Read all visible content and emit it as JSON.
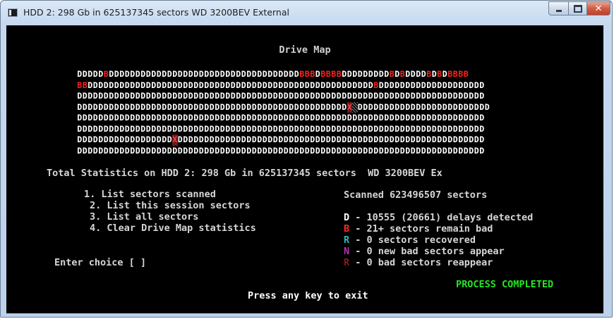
{
  "window": {
    "title": "HDD 2: 298 Gb in 625137345 sectors  WD 3200BEV External",
    "controls": {
      "minimize": "minimize-icon",
      "maximize": "maximize-icon",
      "close": "close-icon"
    }
  },
  "console": {
    "heading": "Drive Map",
    "map_rows": [
      "DDDDDBDDDDDDDDDDDDDDDDDDDDDDDDDDDDDDDDDDDDBBBDBBBBDDDDDDDDDBDBDDDDBDBDBBBB",
      "BBDDDDDDDDDDDDDDDDDDDDDDDDDDDDDDDDDDDDDDDDDDDDDDDDDDDDDDBDDDDDDDDDDDDDDDDDDDD",
      "DDDDDDDDDDDDDDDDDDDDDDDDDDDDDDDDDDDDDDDDDDDDDDDDDDDDDDDDDDDDDDDDDDDDDDDDDDDDD",
      "DDDDDDDDDDDDDDDDDDDDDDDDDDDDDDDDDDDDDDDDDDDDDDDDDDDXHDDDDDDDDDDDDDDDDDDDDDDDDD",
      "DDDDDDDDDDDDDDDDDDDDDDDDDDDDDDDDDDDDDDDDDDDDDDDDDDDDDDDDDDDDDDDDDDDDDDDDDDDDD",
      "DDDDDDDDDDDDDDDDDDDDDDDDDDDDDDDDDDDDDDDDDDDDDDDDDDDDDDDDDDDDDDDDDDDDDDDDDDDDD",
      "DDDDDDDDDDDDDDDDDDXDDDDDDDDDDDDDDDDDDDDDDDDDDDDDDDDDDDDDDDDDDDDDDDDDDDDDDDDDD",
      "DDDDDDDDDDDDDDDDDDDDDDDDDDDDDDDDDDDDDDDDDDDDDDDDDDDDDDDDDDDDDDDDDDDDDDDDDDDDD"
    ],
    "total_statistics": "Total Statistics on HDD 2: 298 Gb in 625137345 sectors  WD 3200BEV Ex",
    "menu": [
      "1. List sectors scanned",
      "2. List this session sectors",
      "3. List all sectors",
      "4. Clear Drive Map statistics"
    ],
    "scanned": "Scanned 623496507 sectors",
    "legend": [
      {
        "key": "D",
        "text": " - 10555 (20661) delays detected"
      },
      {
        "key": "B",
        "text": " - 21+ sectors remain bad"
      },
      {
        "key": "R",
        "text": " - 0 sectors recovered"
      },
      {
        "key": "N",
        "text": " - 0 new bad sectors appear"
      },
      {
        "key": "R",
        "text": " - 0 bad sectors reappear"
      }
    ],
    "prompt": "Enter choice [ ]",
    "status": "PROCESS COMPLETED",
    "exit_hint": "Press any key to exit"
  },
  "colors": {
    "delay": "#ffffff",
    "bad": "#ff2a2a",
    "recovered": "#2fb7b7",
    "new_bad": "#b530b5",
    "reappear": "#8a1a1a",
    "completed": "#22e622"
  }
}
